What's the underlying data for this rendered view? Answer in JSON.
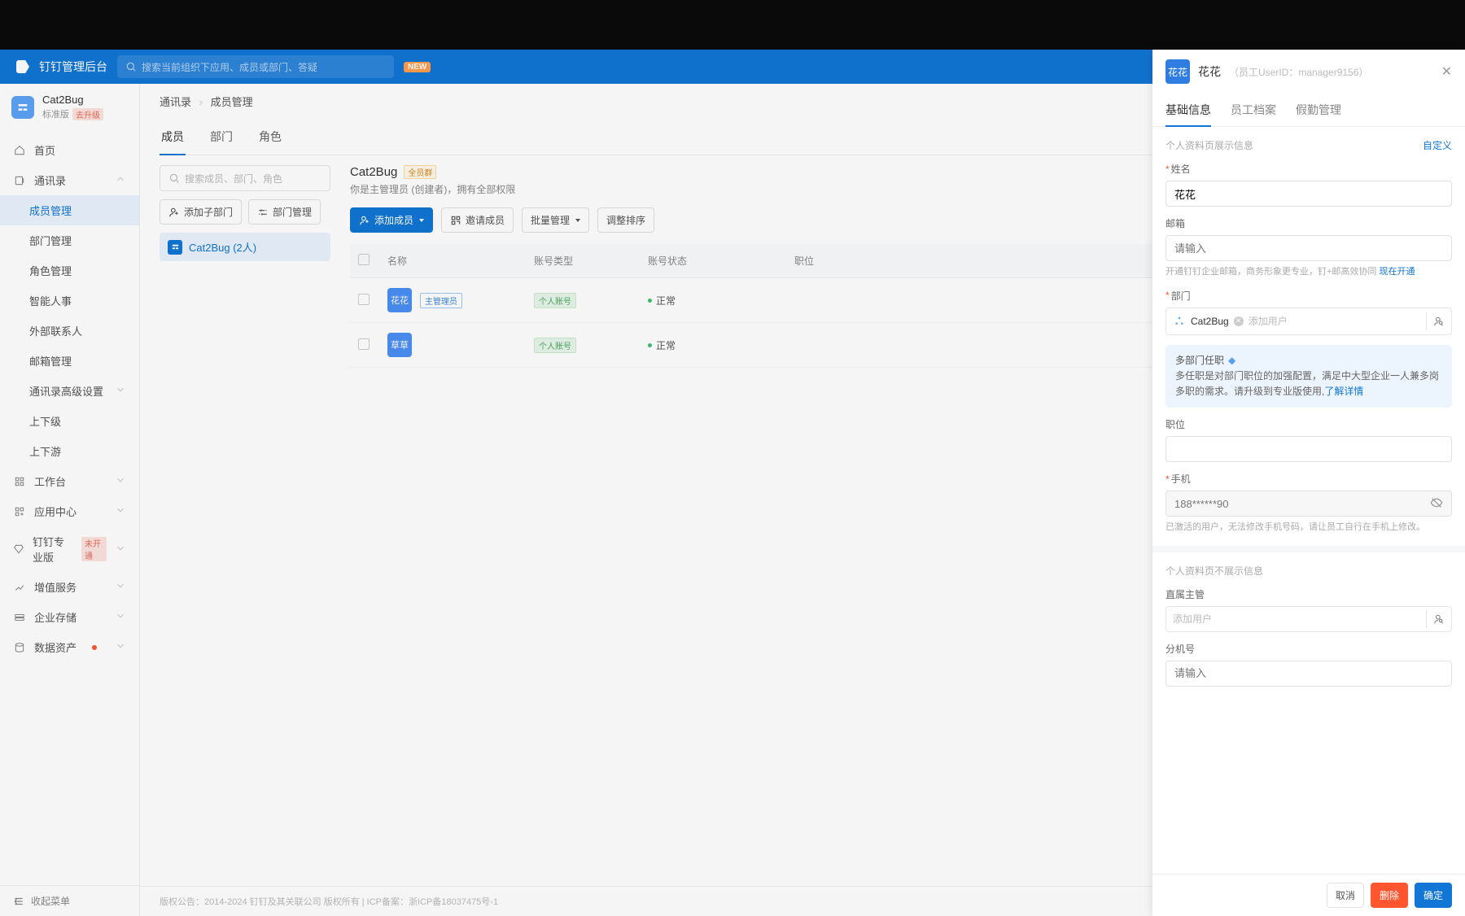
{
  "brand": "钉钉管理后台",
  "searchTop": {
    "placeholder": "搜索当前组织下应用、成员或部门、答疑",
    "badge": "NEW"
  },
  "org": {
    "name": "Cat2Bug",
    "plan": "标准版",
    "badge": "去升级"
  },
  "nav": {
    "home": "首页",
    "contacts": "通讯录",
    "contactsChildren": {
      "members": "成员管理",
      "depts": "部门管理",
      "roles": "角色管理",
      "smartHr": "智能人事",
      "external": "外部联系人",
      "mailbox": "邮箱管理",
      "advanced": "通讯录高级设置",
      "upDown1": "上下级",
      "upDown2": "上下游"
    },
    "workbench": "工作台",
    "appCenter": "应用中心",
    "pro": "钉钉专业版",
    "proBadge": "未开通",
    "vas": "增值服务",
    "storage": "企业存储",
    "dataAssets": "数据资产",
    "collapse": "收起菜单"
  },
  "breadcrumb": {
    "a": "通讯录",
    "b": "成员管理"
  },
  "mainTabs": {
    "members": "成员",
    "depts": "部门",
    "roles": "角色"
  },
  "tree": {
    "searchPlaceholder": "搜索成员、部门、角色",
    "addSubDept": "添加子部门",
    "deptManage": "部门管理",
    "node": "Cat2Bug (2人)"
  },
  "dept": {
    "title": "Cat2Bug",
    "badge": "全员群",
    "subtitle": "你是主管理员 (创建者)，拥有全部权限",
    "toolbar": {
      "addMember": "添加成员",
      "invite": "邀请成员",
      "batch": "批量管理",
      "sort": "调整排序"
    }
  },
  "table": {
    "headers": {
      "name": "名称",
      "acctType": "账号类型",
      "acctStatus": "账号状态",
      "position": "职位"
    },
    "rows": [
      {
        "avatar": "花花",
        "adminTag": "主管理员",
        "acctTag": "个人账号",
        "status": "正常"
      },
      {
        "avatar": "草草",
        "adminTag": "",
        "acctTag": "个人账号",
        "status": "正常"
      }
    ]
  },
  "footer": "版权公告：2014-2024 钉钉及其关联公司 版权所有 | ICP备案：浙ICP备18037475号-1",
  "drawer": {
    "avatar": "花花",
    "name": "花花",
    "uid": "（员工UserID：manager9156）",
    "tabs": {
      "basic": "基础信息",
      "employee": "员工档案",
      "attendance": "假勤管理"
    },
    "secShow": "个人资料页展示信息",
    "customize": "自定义",
    "fields": {
      "name": {
        "label": "姓名",
        "value": "花花"
      },
      "email": {
        "label": "邮箱",
        "placeholder": "请输入",
        "hint1": "开通钉钉企业邮箱，商务形象更专业，钉+邮高效协同 ",
        "hintLink": "现在开通"
      },
      "dept": {
        "label": "部门",
        "chip": "Cat2Bug",
        "placeholder": "添加用户"
      },
      "multiDept": {
        "title": "多部门任职",
        "body": "多任职是对部门职位的加强配置，满足中大型企业一人兼多岗多职的需求。请升级到专业版使用,",
        "link": "了解详情"
      },
      "position": {
        "label": "职位"
      },
      "phone": {
        "label": "手机",
        "value": "188******90",
        "hint": "已激活的用户，无法修改手机号码，请让员工自行在手机上修改。"
      },
      "secHide": "个人资料页不展示信息",
      "manager": {
        "label": "直属主管",
        "placeholder": "添加用户"
      },
      "ext": {
        "label": "分机号",
        "placeholder": "请输入"
      }
    },
    "footer": {
      "cancel": "取消",
      "delete": "删除",
      "confirm": "确定"
    }
  }
}
